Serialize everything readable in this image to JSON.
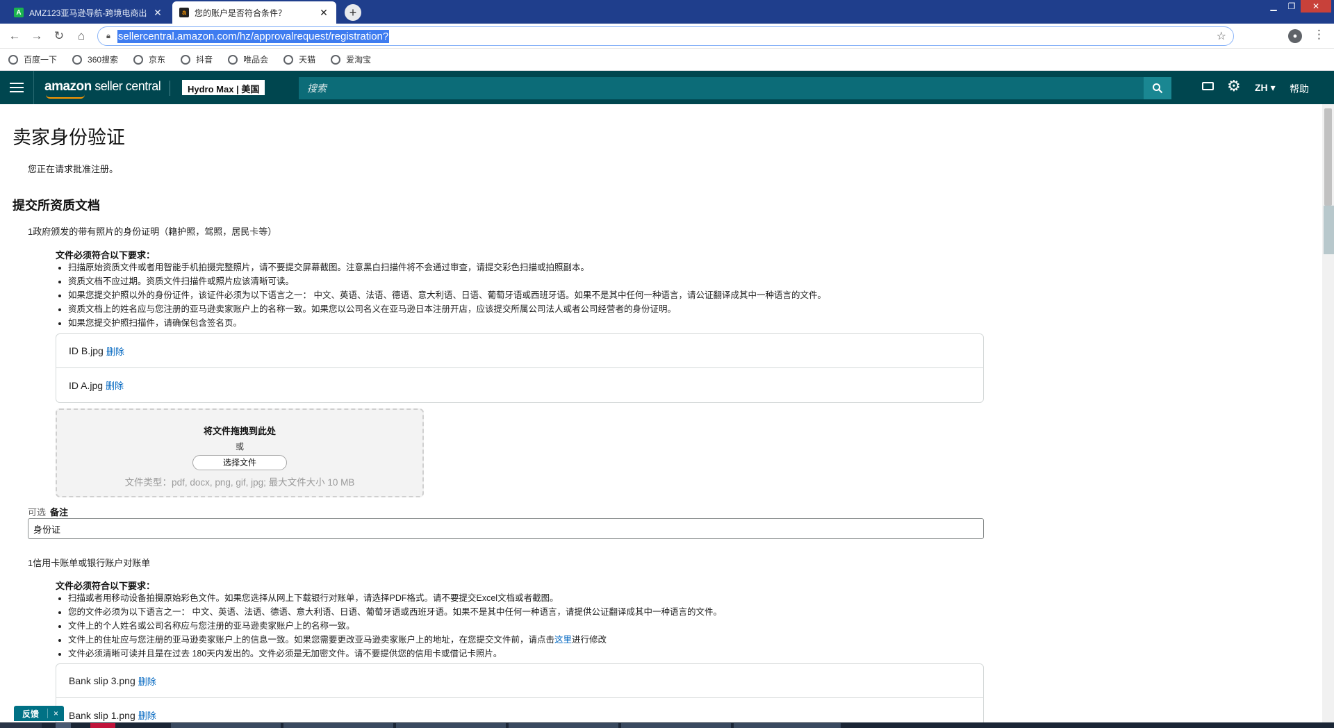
{
  "browser": {
    "tabs": [
      {
        "label": "AMZ123亚马逊导航-跨境电商出",
        "active": false
      },
      {
        "label": "您的账户是否符合条件？",
        "active": true
      }
    ],
    "new_tab": "+",
    "url": "sellercentral.amazon.com/hz/approvalrequest/registration?",
    "bookmarks": [
      "百度一下",
      "360搜索",
      "京东",
      "抖音",
      "唯品会",
      "天猫",
      "爱淘宝"
    ]
  },
  "header": {
    "logo_brand": "amazon",
    "logo_product": " seller central",
    "store": "Hydro Max | 美国",
    "search_placeholder": "搜索",
    "lang": "ZH",
    "help": "帮助"
  },
  "page": {
    "title": "卖家身份验证",
    "intro": "您正在请求批准注册。",
    "section_title": "提交所资质文档"
  },
  "doc1": {
    "title": "1政府颁发的带有照片的身份证明（籍护照，驾照，居民卡等）",
    "req_head": "文件必须符合以下要求：",
    "requirements": [
      "扫描原始资质文件或者用智能手机拍摄完整照片，请不要提交屏幕截图。注意黑白扫描件将不会通过审查，请提交彩色扫描或拍照副本。",
      "资质文档不应过期。资质文件扫描件或照片应该清晰可读。",
      "如果您提交护照以外的身份证件，该证件必须为以下语言之一： 中文、英语、法语、德语、意大利语、日语、葡萄牙语或西班牙语。如果不是其中任何一种语言，请公证翻译成其中一种语言的文件。",
      "资质文档上的姓名应与您注册的亚马逊卖家账户上的名称一致。如果您以公司名义在亚马逊日本注册开店，应该提交所属公司法人或者公司经营者的身份证明。",
      "如果您提交护照扫描件，请确保包含签名页。"
    ],
    "files": [
      "ID B.jpg",
      "ID A.jpg"
    ],
    "delete_label": "删除"
  },
  "dropzone": {
    "title": "将文件拖拽到此处",
    "or": "或",
    "button": "选择文件",
    "types": "文件类型：pdf, docx, png, gif, jpg; 最大文件大小 10 MB"
  },
  "note": {
    "optional": "可选",
    "label": "备注",
    "value": "身份证"
  },
  "doc2": {
    "title": "1信用卡账单或银行账户对账单",
    "req_head": "文件必须符合以下要求：",
    "requirements": [
      "扫描或者用移动设备拍摄原始彩色文件。如果您选择从网上下载银行对账单，请选择PDF格式。请不要提交Excel文档或者截图。",
      "您的文件必须为以下语言之一： 中文、英语、法语、德语、意大利语、日语、葡萄牙语或西班牙语。如果不是其中任何一种语言，请提供公证翻译成其中一种语言的文件。",
      "文件上的个人姓名或公司名称应与您注册的亚马逊卖家账户上的名称一致。"
    ],
    "req4_before": "文件上的住址应与您注册的亚马逊卖家账户上的信息一致。如果您需要更改亚马逊卖家账户上的地址，在您提交文件前，请点击",
    "req4_link": "这里",
    "req4_after": "进行修改",
    "req5": "文件必须清晰可读并且是在过去 180天内发出的。文件必须是无加密文件。请不要提供您的信用卡或借记卡照片。",
    "files": [
      "Bank slip 3.png",
      "Bank slip 1.png"
    ],
    "delete_label": "删除"
  },
  "feedback": {
    "label": "反馈",
    "close": "×"
  }
}
